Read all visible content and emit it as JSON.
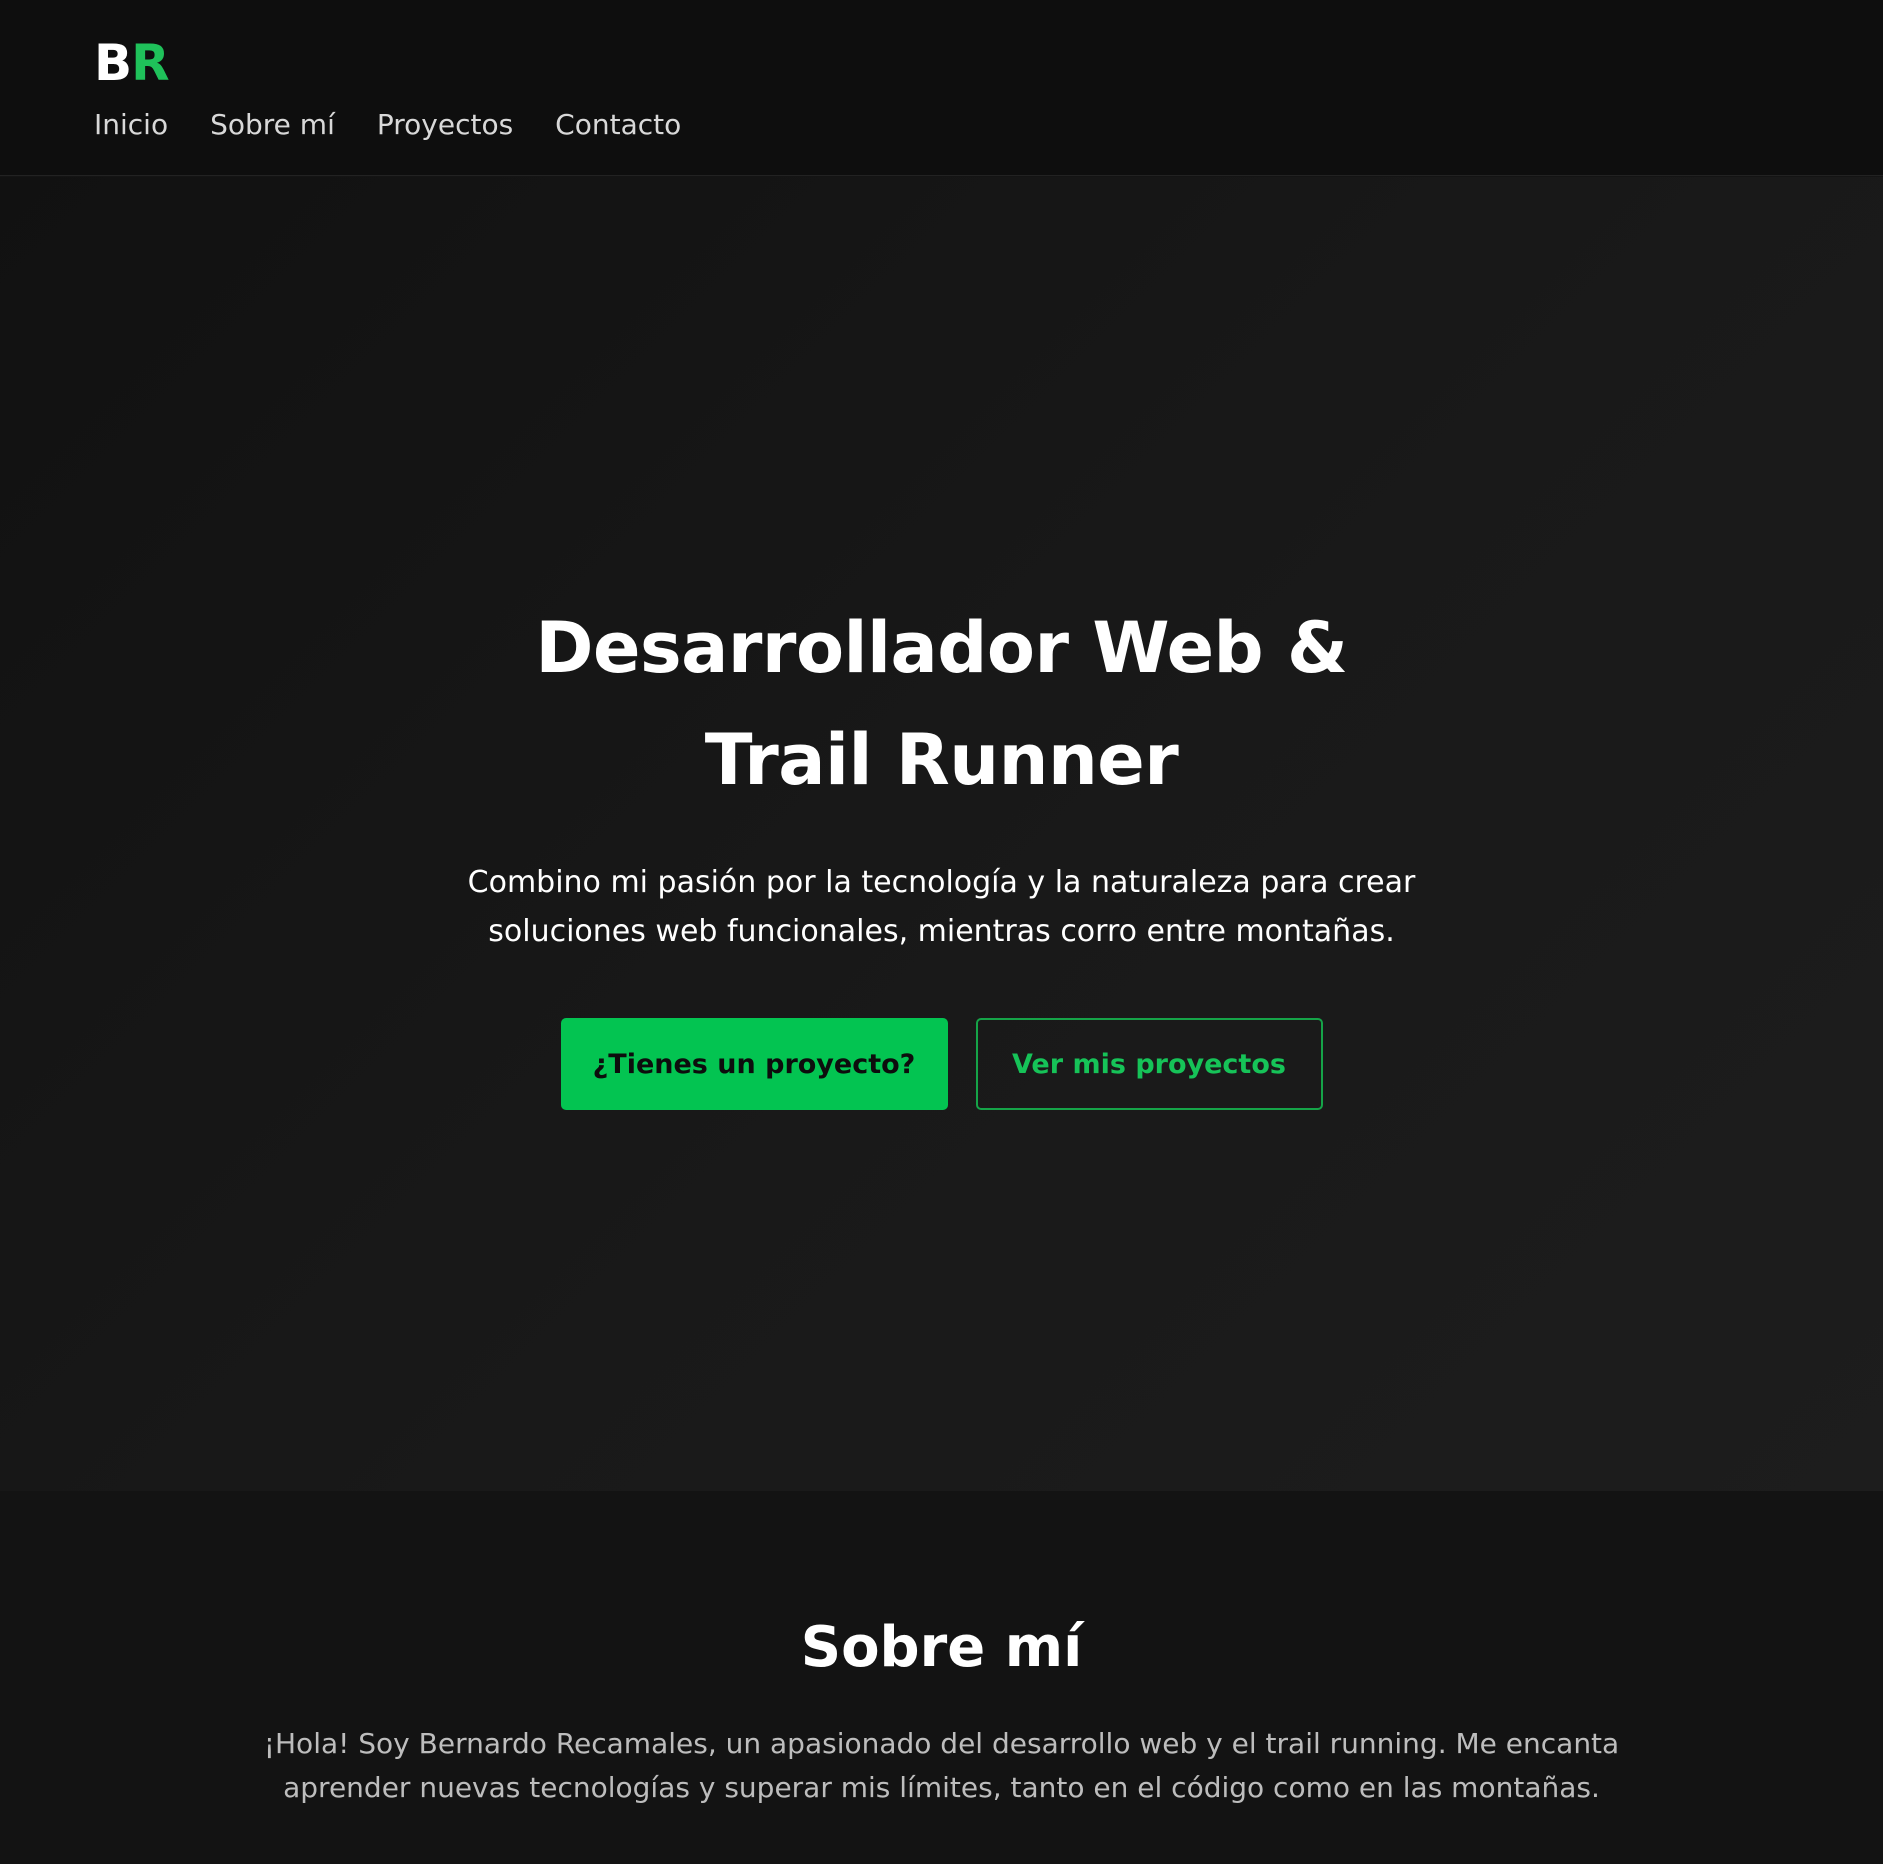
{
  "brand": {
    "logo_first": "B",
    "logo_second": "R",
    "accent_color": "#03c451"
  },
  "nav": {
    "items": [
      "Inicio",
      "Sobre mí",
      "Proyectos",
      "Contacto"
    ]
  },
  "hero": {
    "title": "Desarrollador Web & Trail Runner",
    "subtitle": "Combino mi pasión por la tecnología y la naturaleza para crear soluciones web funcionales, mientras corro entre montañas.",
    "primary_button": "¿Tienes un proyecto?",
    "secondary_button": "Ver mis proyectos"
  },
  "about": {
    "title": "Sobre mí",
    "text": "¡Hola! Soy Bernardo Recamales, un apasionado del desarrollo web y el trail running. Me encanta aprender nuevas tecnologías y superar mis límites, tanto en el código como en las montañas."
  }
}
